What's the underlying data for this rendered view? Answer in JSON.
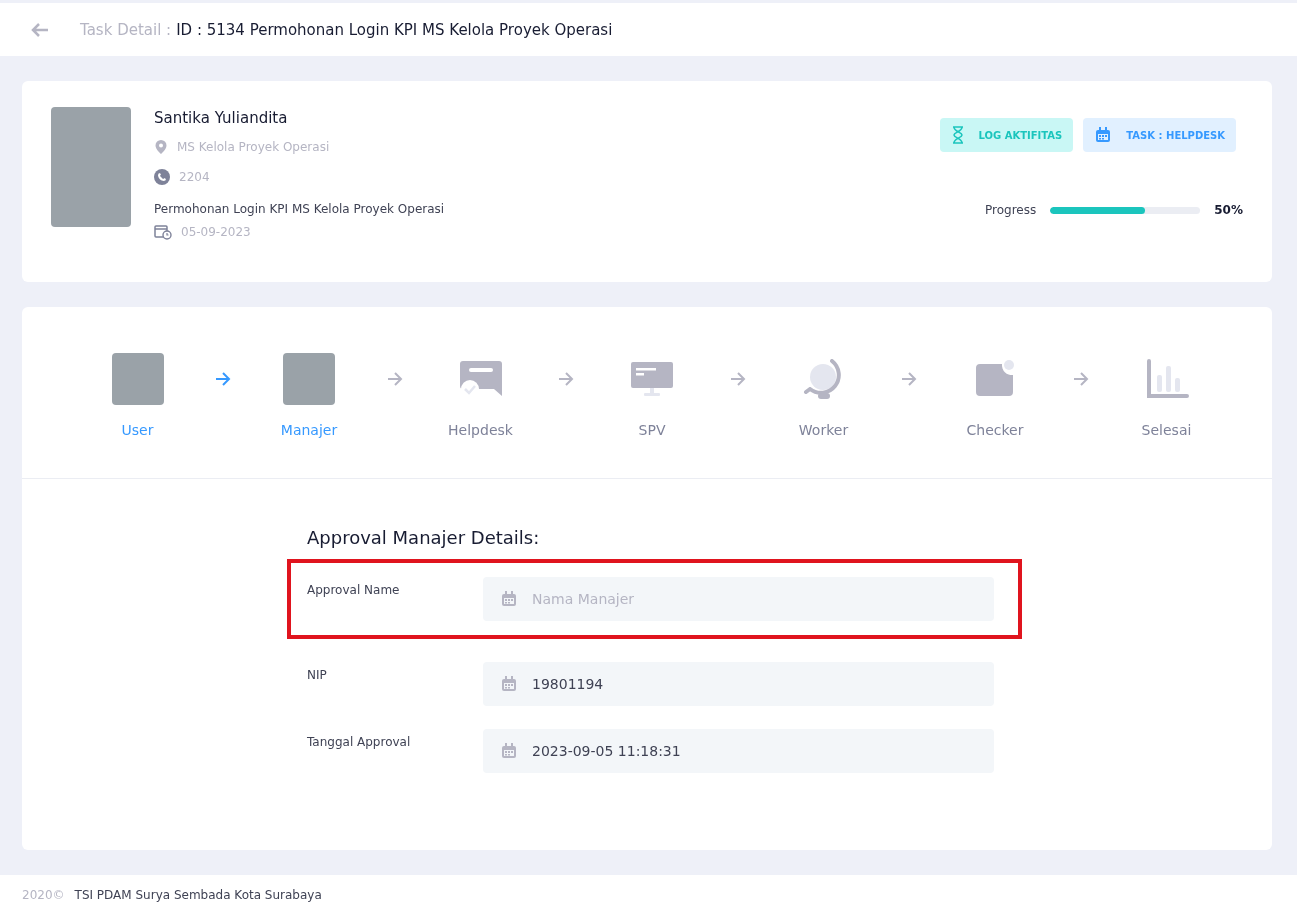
{
  "header": {
    "title_prefix": "Task Detail :",
    "title": "ID : 5134 Permohonan Login KPI MS Kelola Proyek Operasi"
  },
  "profile": {
    "name": "Santika Yuliandita",
    "unit": "MS Kelola Proyek Operasi",
    "phone": "2204",
    "subject": "Permohonan Login KPI MS Kelola Proyek Operasi",
    "date": "05-09-2023",
    "buttons": [
      {
        "kind": "log",
        "label": "LOG AKTIFITAS"
      },
      {
        "kind": "task",
        "label": "TASK : HELPDESK"
      }
    ],
    "progress": {
      "label": "Progress",
      "level": 0.63,
      "reading": "50%"
    }
  },
  "steps": [
    {
      "kind": "photo",
      "label": "User",
      "done": true
    },
    {
      "kind": "photo",
      "label": "Manajer",
      "done": true
    },
    {
      "kind": "chat",
      "label": "Helpdesk",
      "done": false
    },
    {
      "kind": "monitor",
      "label": "SPV",
      "done": false
    },
    {
      "kind": "globe",
      "label": "Worker",
      "done": false
    },
    {
      "kind": "note",
      "label": "Checker",
      "done": false
    },
    {
      "kind": "chart",
      "label": "Selesai",
      "done": false
    }
  ],
  "details": {
    "title": "Approval Manajer Details:",
    "fields": [
      {
        "label": "Approval Name",
        "placeholder": "Nama Manajer",
        "highlighted": true
      },
      {
        "label": "NIP",
        "value": "19801194",
        "highlighted": false
      },
      {
        "label": "Tanggal Approval",
        "value": "2023-09-05 11:18:31",
        "highlighted": false
      }
    ]
  },
  "footer": {
    "year": "2020©",
    "text": "TSI PDAM Surya Sembada Kota Surabaya"
  }
}
